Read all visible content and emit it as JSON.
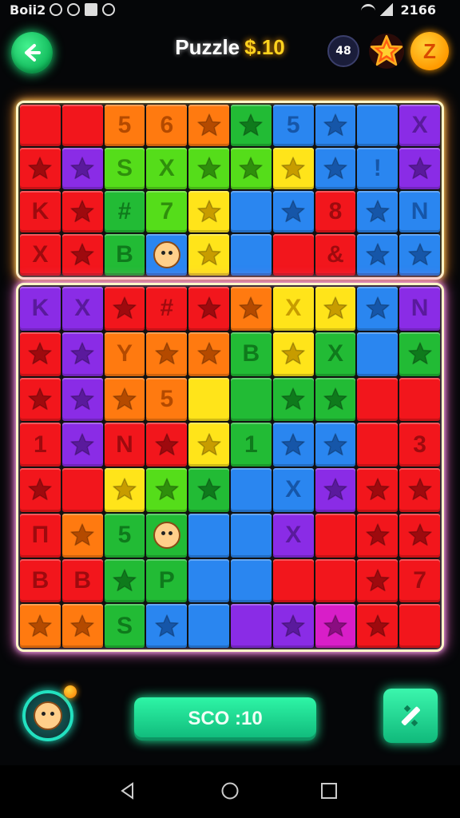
{
  "status_bar": {
    "left_text": "Boii2",
    "right_text": "2166"
  },
  "header": {
    "title_prefix": "Puzzle",
    "title_value": "$.10",
    "moves_badge": "48",
    "coin_label": "Z"
  },
  "colors": {
    "red": "#f2161c",
    "orange": "#ff7a10",
    "yellow": "#ffe41a",
    "lime": "#55dd1a",
    "green": "#22bb35",
    "blue": "#2a86f0",
    "purple": "#8a2ce6",
    "pink": "#d81ec8"
  },
  "top_board": [
    [
      "red",
      "red",
      "orange:5",
      "orange:6",
      "orange:*",
      "green:*",
      "blue:5",
      "blue:*",
      "blue",
      "purple:X"
    ],
    [
      "red:*",
      "purple:*",
      "lime:S",
      "lime:X",
      "lime:*",
      "lime:*",
      "yellow:*",
      "blue:*",
      "blue:!",
      "purple:*"
    ],
    [
      "red:K",
      "red:*",
      "green:#",
      "lime:7",
      "yellow:*",
      "blue",
      "blue:*",
      "red:8",
      "blue:*",
      "blue:N"
    ],
    [
      "red:X",
      "red:*",
      "green:B",
      "blue:@",
      "yellow:*",
      "blue",
      "red",
      "red:&",
      "blue:*",
      "blue:*"
    ]
  ],
  "bottom_board": [
    [
      "purple:K",
      "purple:X",
      "red:*",
      "red:#",
      "red:*",
      "orange:*",
      "yellow:X",
      "yellow:*",
      "blue:*",
      "purple:N"
    ],
    [
      "red:*",
      "purple:*",
      "orange:Y",
      "orange:*",
      "orange:*",
      "green:B",
      "yellow:*",
      "green:X",
      "blue",
      "green:*"
    ],
    [
      "red:*",
      "purple:*",
      "orange:*",
      "orange:5",
      "yellow",
      "green",
      "green:*",
      "green:*",
      "red",
      "red"
    ],
    [
      "red:1",
      "purple:*",
      "red:N",
      "red:*",
      "yellow:*",
      "green:1",
      "blue:*",
      "blue:*",
      "red",
      "red:3"
    ],
    [
      "red:*",
      "red",
      "yellow:*",
      "lime:*",
      "green:*",
      "blue",
      "blue:X",
      "purple:*",
      "red:*",
      "red:*"
    ],
    [
      "red:П",
      "orange:*",
      "green:5",
      "green:@",
      "blue",
      "blue",
      "purple:X",
      "red",
      "red:*",
      "red:*"
    ],
    [
      "red:B",
      "red:B",
      "green:*",
      "green:P",
      "blue",
      "blue",
      "red",
      "red",
      "red:*",
      "red:7"
    ],
    [
      "orange:*",
      "orange:*",
      "green:S",
      "blue:*",
      "blue",
      "purple",
      "purple:*",
      "pink:*",
      "red:*",
      "red"
    ]
  ],
  "footer": {
    "score_label": "SCO :10"
  },
  "nav": {
    "back": "back-icon",
    "home": "home-icon",
    "recents": "recents-icon"
  }
}
